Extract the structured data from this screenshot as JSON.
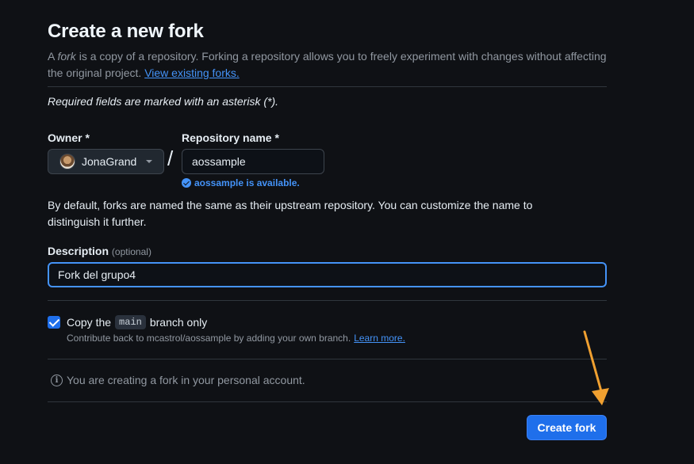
{
  "header": {
    "title": "Create a new fork",
    "intro_prefix": "A ",
    "intro_em": "fork",
    "intro_rest": " is a copy of a repository. Forking a repository allows you to freely experiment with changes without affecting the original project.",
    "view_forks_link": "View existing forks."
  },
  "form": {
    "required_note": "Required fields are marked with an asterisk (*).",
    "owner": {
      "label": "Owner *",
      "value": "JonaGrand"
    },
    "slash": "/",
    "repo": {
      "label": "Repository name *",
      "value": "aossample",
      "availability": "aossample is available."
    },
    "naming_help": "By default, forks are named the same as their upstream repository. You can customize the name to distinguish it further.",
    "description": {
      "label": "Description",
      "optional": "(optional)",
      "value": "Fork del grupo4"
    },
    "copy_branch": {
      "checked": true,
      "label_prefix": "Copy the",
      "branch": "main",
      "label_suffix": "branch only",
      "help": "Contribute back to mcastrol/aossample by adding your own branch.",
      "learn_more": "Learn more."
    },
    "info": {
      "icon": "info-icon",
      "text": "You are creating a fork in your personal account."
    },
    "submit_label": "Create fork"
  },
  "annotation": {
    "arrow_color": "#f0a030"
  },
  "colors": {
    "background": "#0f1115",
    "accent": "#4493f8",
    "primary_button": "#1f6feb"
  }
}
